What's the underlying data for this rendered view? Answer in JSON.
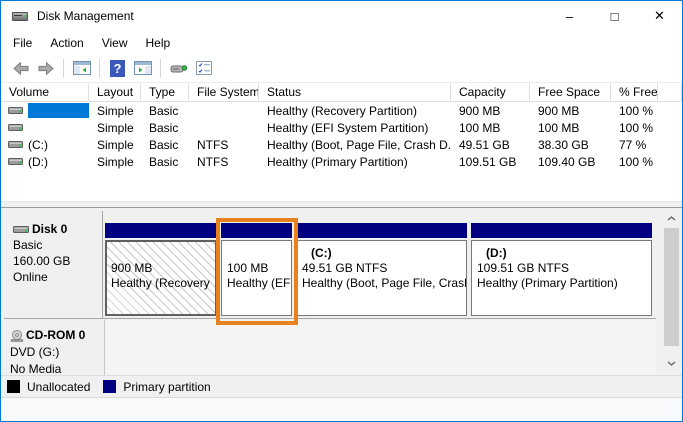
{
  "window": {
    "title": "Disk Management",
    "controls": {
      "minimize": "–",
      "maximize": "□",
      "close": "✕"
    }
  },
  "menu": {
    "items": [
      "File",
      "Action",
      "View",
      "Help"
    ]
  },
  "toolbar": {
    "icons": [
      "back",
      "forward",
      "show-console-tree",
      "help",
      "show-action-pane",
      "disk-properties",
      "checklist"
    ]
  },
  "volume_list": {
    "columns": [
      "Volume",
      "Layout",
      "Type",
      "File System",
      "Status",
      "Capacity",
      "Free Space",
      "% Free"
    ],
    "rows": [
      {
        "volume": "",
        "layout": "Simple",
        "type": "Basic",
        "file_system": "",
        "status": "Healthy (Recovery Partition)",
        "capacity": "900 MB",
        "free_space": "900 MB",
        "pct_free": "100 %"
      },
      {
        "volume": "",
        "layout": "Simple",
        "type": "Basic",
        "file_system": "",
        "status": "Healthy (EFI System Partition)",
        "capacity": "100 MB",
        "free_space": "100 MB",
        "pct_free": "100 %"
      },
      {
        "volume": "(C:)",
        "layout": "Simple",
        "type": "Basic",
        "file_system": "NTFS",
        "status": "Healthy (Boot, Page File, Crash D...",
        "capacity": "49.51 GB",
        "free_space": "38.30 GB",
        "pct_free": "77 %"
      },
      {
        "volume": "(D:)",
        "layout": "Simple",
        "type": "Basic",
        "file_system": "NTFS",
        "status": "Healthy (Primary Partition)",
        "capacity": "109.51 GB",
        "free_space": "109.40 GB",
        "pct_free": "100 %"
      }
    ]
  },
  "disk0": {
    "name": "Disk 0",
    "kind": "Basic",
    "size": "160.00 GB",
    "state": "Online",
    "partitions": [
      {
        "title": "",
        "size": "900 MB",
        "status": "Healthy (Recovery"
      },
      {
        "title": "",
        "size": "100 MB",
        "status": "Healthy (EF"
      },
      {
        "title": "(C:)",
        "size": "49.51 GB NTFS",
        "status": "Healthy (Boot, Page File, Crash"
      },
      {
        "title": "(D:)",
        "size": "109.51 GB NTFS",
        "status": "Healthy (Primary Partition)"
      }
    ]
  },
  "cdrom": {
    "name": "CD-ROM 0",
    "media": "DVD (G:)",
    "status": "No Media"
  },
  "legend": {
    "items": [
      {
        "label": "Unallocated",
        "color": "#000000"
      },
      {
        "label": "Primary partition",
        "color": "#000080"
      }
    ]
  },
  "colors": {
    "window_border": "#0078d7",
    "partition_bar": "#000080",
    "annotation_box": "#e8821e",
    "selection": "#0078d7"
  }
}
